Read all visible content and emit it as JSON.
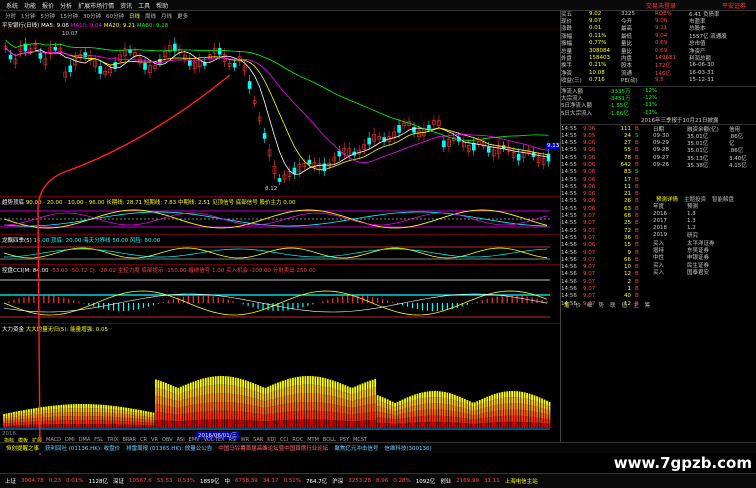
{
  "menu": {
    "items": [
      "系统",
      "功能",
      "报价",
      "分析",
      "扩展市场行情",
      "资讯",
      "工具",
      "帮助"
    ],
    "brand_left": "交易未登录",
    "brand_right": "平安证券"
  },
  "periods": [
    "分时",
    "1分钟",
    "5分钟",
    "15分钟",
    "30分钟",
    "60分钟",
    "日线",
    "周线",
    "月线",
    "更多"
  ],
  "periods_active": "日线",
  "main_chart": {
    "title": "平安银行(日线)",
    "ma5": "MA5: 9.06",
    "ma10": "MA10: 9.04",
    "ma20": "MA20: 9.21",
    "ma60": "MA60: 9.18",
    "high_label": "10.07",
    "low_label": "8.12",
    "price_mark": "9.13"
  },
  "indicators": [
    {
      "name": "趋势顶底",
      "text": "90.00 · 20.00 · 10.00 · 96.00 长期线: 28.71 短期线: 7.83 中期线: 2.51 见顶信号 底部信号 股价主力 0.00"
    },
    {
      "name": "龙飘四季(5)",
      "text": "16.00 顶底: 20.00 海天分界线 50.00 风险: 80.00"
    },
    {
      "name": "控盘CCI(M: 84.00",
      "text": "-53.03 -50.72 CJ: -28.02 主控力度 底部提示 -150.00 缠绕信号 1.00 买入机会 -200.00 分批卖出 250.00"
    },
    {
      "name": "大力资金",
      "text": "大大的量无归(5): 能量增强: 0.05"
    }
  ],
  "bottom_axis": {
    "left": "2016",
    "date": "2016/06/01/三"
  },
  "bottom_tabs": [
    "指标",
    "模板",
    "扩展"
  ],
  "bottom_tab_items": [
    "MACD",
    "DMI",
    "DMA",
    "FSL",
    "TRIX",
    "BRAR",
    "CR",
    "VR",
    "OBV",
    "ASI",
    "EMV",
    "VOL-TEX",
    "RSI",
    "WR",
    "SAR",
    "KDJ",
    "CCI",
    "ROC",
    "MTM",
    "BOLL",
    "PSY",
    "MCST"
  ],
  "right_panel": {
    "quote_rows": [
      {
        "l": "买五",
        "v": "9.02",
        "v2": "3225",
        "r1": "ROE%",
        "r2": "6.41 负债率"
      },
      {
        "l": "现价",
        "v": "9.07",
        "v2": "今开",
        "r1": "9.06",
        "r2": "市盈率"
      },
      {
        "l": "涨跌",
        "v": "0.01",
        "v2": "最高",
        "r1": "9.11",
        "r2": "总股本"
      },
      {
        "l": "涨幅",
        "v": "0.11%",
        "v2": "最低",
        "r1": "9.04",
        "r2": "1557亿 流通股"
      },
      {
        "l": "振幅",
        "v": "0.77%",
        "v2": "量比",
        "r1": "0.69",
        "r2": "总市值"
      },
      {
        "l": "总量",
        "v": "308084",
        "v2": "量比",
        "r1": "0.69",
        "r2": "净资产"
      },
      {
        "l": "外盘",
        "v": "158403",
        "v2": "内盘",
        "r1": "149681",
        "r2": "利润总额"
      },
      {
        "l": "换手",
        "v": "0.21%",
        "v2": "股本",
        "r1": "172亿",
        "r2": "16-06-30"
      },
      {
        "l": "净资",
        "v": "10.08",
        "v2": "流通",
        "r1": "146亿",
        "r2": "16-03-31"
      },
      {
        "l": "收益(三)",
        "v": "0.716",
        "v2": "PE(动)",
        "r1": "9.5",
        "r2": "15-12-31"
      }
    ],
    "flow_rows": [
      {
        "l": "净流入额",
        "v": "-3335万",
        "c": "-12%"
      },
      {
        "l": "大宗流入",
        "v": "-3451万",
        "c": "-12%"
      },
      {
        "l": "5日净流入额",
        "v": "-1.55亿",
        "c": "-11%"
      },
      {
        "l": "5日大宗流入",
        "v": "-1.66亿",
        "c": "-11%"
      }
    ],
    "flow_note": "2016年三季报于10月21日披露",
    "finance_rows": [
      {
        "d": "日期",
        "a": "融资余额(亿)"
      },
      {
        "d": "09-30",
        "a": "35.01亿"
      },
      {
        "d": "09-29",
        "a": "35.01亿"
      },
      {
        "d": "09-28",
        "a": "35.01亿"
      },
      {
        "d": "09-27",
        "a": "35.13亿"
      },
      {
        "d": "09-26",
        "a": "35.38亿"
      }
    ],
    "finance_right": [
      "信用",
      ".86亿",
      "亿",
      ".86亿",
      "3.40亿",
      "4.15亿"
    ],
    "ticks": [
      {
        "t": "14:55",
        "p": "9.06",
        "v": "111",
        "s": "B"
      },
      {
        "t": "14:55",
        "p": "9.05",
        "v": "24",
        "s": "S"
      },
      {
        "t": "14:55",
        "p": "9.06",
        "v": "27",
        "s": "B"
      },
      {
        "t": "14:55",
        "p": "9.06",
        "v": "55",
        "s": "B"
      },
      {
        "t": "14:55",
        "p": "9.06",
        "v": "78",
        "s": "B"
      },
      {
        "t": "14:55",
        "p": "9.06",
        "v": "642",
        "s": "B"
      },
      {
        "t": "14:55",
        "p": "9.06",
        "v": "83",
        "s": "S"
      },
      {
        "t": "14:55",
        "p": "9.06",
        "v": "17",
        "s": "B"
      },
      {
        "t": "14:55",
        "p": "9.06",
        "v": "11",
        "s": "B"
      },
      {
        "t": "14:55",
        "p": "9.06",
        "v": "21",
        "s": "B"
      },
      {
        "t": "14:55",
        "p": "9.06",
        "v": "26",
        "s": "B"
      },
      {
        "t": "14:55",
        "p": "9.06",
        "v": "63",
        "s": "B"
      },
      {
        "t": "14:55",
        "p": "9.07",
        "v": "68",
        "s": "B"
      },
      {
        "t": "14:55",
        "p": "9.07",
        "v": "25",
        "s": "B"
      },
      {
        "t": "14:55",
        "p": "9.07",
        "v": "72",
        "s": "B"
      },
      {
        "t": "14:55",
        "p": "9.07",
        "v": "36",
        "s": "B"
      },
      {
        "t": "14:56",
        "p": "9.06",
        "v": "15",
        "s": "B"
      },
      {
        "t": "14:56",
        "p": "9.07",
        "v": "9",
        "s": "B"
      },
      {
        "t": "14:56",
        "p": "9.07",
        "v": "66",
        "s": "B"
      },
      {
        "t": "14:56",
        "p": "9.07",
        "v": "10",
        "s": "B"
      },
      {
        "t": "14:56",
        "p": "9.07",
        "v": "12",
        "s": "B"
      },
      {
        "t": "14:56",
        "p": "9.07",
        "v": "2",
        "s": "B"
      },
      {
        "t": "14:56",
        "p": "9.07",
        "v": "1",
        "s": "B"
      },
      {
        "t": "14:56",
        "p": "9.07",
        "v": "40",
        "s": "B"
      },
      {
        "t": "14:56",
        "p": "9.07",
        "v": "12",
        "s": "B"
      }
    ],
    "dragon_tabs": [
      "预测详情",
      "主题投资",
      "智能解盘"
    ],
    "dragon_rows": [
      {
        "y": "年度",
        "a": "预测"
      },
      {
        "y": "2016",
        "a": "1.3"
      },
      {
        "y": "2017",
        "a": "1.3"
      },
      {
        "y": "2018",
        "a": "1.2"
      },
      {
        "y": "2019",
        "a": "研究"
      }
    ],
    "rating_rows": [
      {
        "r": "买入",
        "o": "太平洋证券"
      },
      {
        "r": "增持",
        "o": "东吴证券"
      },
      {
        "r": "中性",
        "o": "申银证券"
      },
      {
        "r": "买入",
        "o": "民生证券"
      },
      {
        "r": "买入",
        "o": "国泰君安"
      }
    ],
    "bottom_tabs": [
      "笔",
      "价",
      "细",
      "势",
      "联",
      "值",
      "主",
      "筹"
    ]
  },
  "ticker": [
    {
      "t": "恒创提醒之事",
      "c": "#ff0"
    },
    {
      "t": "获利回吐 (01136.HK): 收盘价",
      "c": "#6cf"
    },
    {
      "t": "排雷周报 (01365.HK): 放量公公告",
      "c": "#6cf"
    },
    {
      "t": "中国马铃薯首届高峰论坛暨中国首席行业论坛",
      "c": "#f66"
    },
    {
      "t": "聚焦亿元冲击信号",
      "c": "#6cf"
    },
    {
      "t": "信维科技(300136)",
      "c": "#6cf"
    }
  ],
  "status": [
    {
      "t": "上证",
      "c": "#fff"
    },
    {
      "t": "3004.78",
      "c": "#f44"
    },
    {
      "t": "0.23",
      "c": "#f44"
    },
    {
      "t": "0.01%",
      "c": "#f44"
    },
    {
      "t": "1128亿",
      "c": "#fff"
    },
    {
      "t": "深证",
      "c": "#fff"
    },
    {
      "t": "10567.6",
      "c": "#f44"
    },
    {
      "t": "55.53",
      "c": "#f44"
    },
    {
      "t": "0.53%",
      "c": "#f44"
    },
    {
      "t": "1859亿",
      "c": "#fff"
    },
    {
      "t": "中",
      "c": "#fff"
    },
    {
      "t": "6758.39",
      "c": "#f44"
    },
    {
      "t": "34.17",
      "c": "#f44"
    },
    {
      "t": "0.51%",
      "c": "#f44"
    },
    {
      "t": "764.7亿",
      "c": "#fff"
    },
    {
      "t": "沪深",
      "c": "#fff"
    },
    {
      "t": "3253.28",
      "c": "#f44"
    },
    {
      "t": "8.96",
      "c": "#f44"
    },
    {
      "t": "0.28%",
      "c": "#f44"
    },
    {
      "t": "1092亿",
      "c": "#fff"
    },
    {
      "t": "创业",
      "c": "#fff"
    },
    {
      "t": "2169.99",
      "c": "#f44"
    },
    {
      "t": "31.11",
      "c": "#f44"
    },
    {
      "t": "上海电信主站",
      "c": "#ff0"
    }
  ],
  "watermark": "www.7gpzb.com",
  "colors": {
    "up": "#ff3333",
    "down": "#00ff00",
    "panel_bg": "#000000",
    "accent": "#ffff00"
  }
}
